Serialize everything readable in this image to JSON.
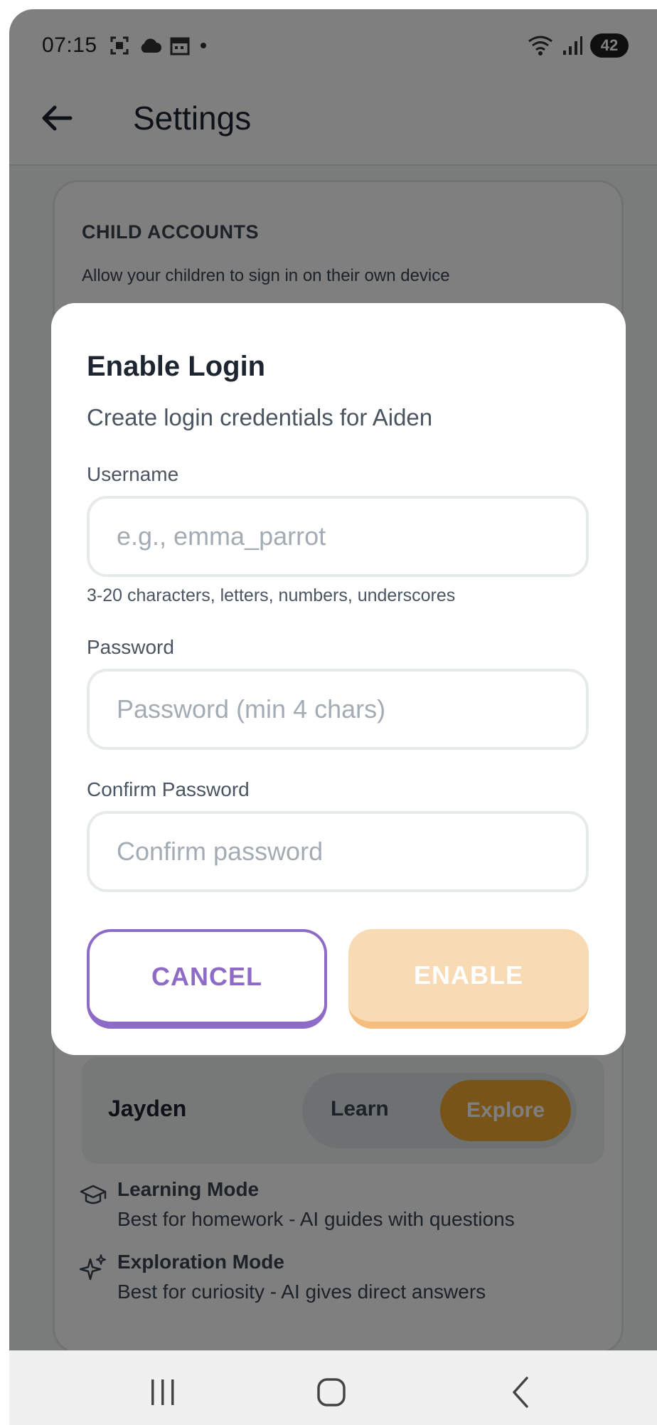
{
  "status_bar": {
    "time": "07:15",
    "left_icons": [
      "screenshot-icon",
      "cloud-icon",
      "calendar-icon",
      "dot-icon"
    ],
    "right_icons": [
      "wifi-icon",
      "signal-icon"
    ],
    "battery": "42"
  },
  "app_bar": {
    "title": "Settings",
    "back_icon": "arrow-left-icon"
  },
  "settings": {
    "section_heading": "CHILD ACCOUNTS",
    "section_description": "Allow your children to sign in on their own device",
    "child_row": {
      "name": "Jayden",
      "modes": [
        "Learn",
        "Explore"
      ],
      "selected_mode": "Explore"
    },
    "legend": [
      {
        "icon": "graduation-cap-icon",
        "title": "Learning Mode",
        "description": "Best for homework - AI guides with questions"
      },
      {
        "icon": "sparkles-icon",
        "title": "Exploration Mode",
        "description": "Best for curiosity - AI gives direct answers"
      }
    ]
  },
  "dialog": {
    "title": "Enable Login",
    "subtitle": "Create login credentials for Aiden",
    "username": {
      "label": "Username",
      "placeholder": "e.g., emma_parrot",
      "value": "",
      "hint": "3-20 characters, letters, numbers, underscores"
    },
    "password": {
      "label": "Password",
      "placeholder": "Password (min 4 chars)",
      "value": ""
    },
    "confirm_password": {
      "label": "Confirm Password",
      "placeholder": "Confirm password",
      "value": ""
    },
    "cancel_label": "CANCEL",
    "enable_label": "ENABLE"
  },
  "nav_bar": {
    "buttons": [
      "recent-apps-icon",
      "home-icon",
      "back-icon"
    ]
  },
  "colors": {
    "accent_purple": "#8e6bc7",
    "accent_orange": "#f0a833",
    "enable_disabled": "#f8dbb4",
    "text_dark": "#1c2530",
    "text_muted": "#4a5561"
  }
}
